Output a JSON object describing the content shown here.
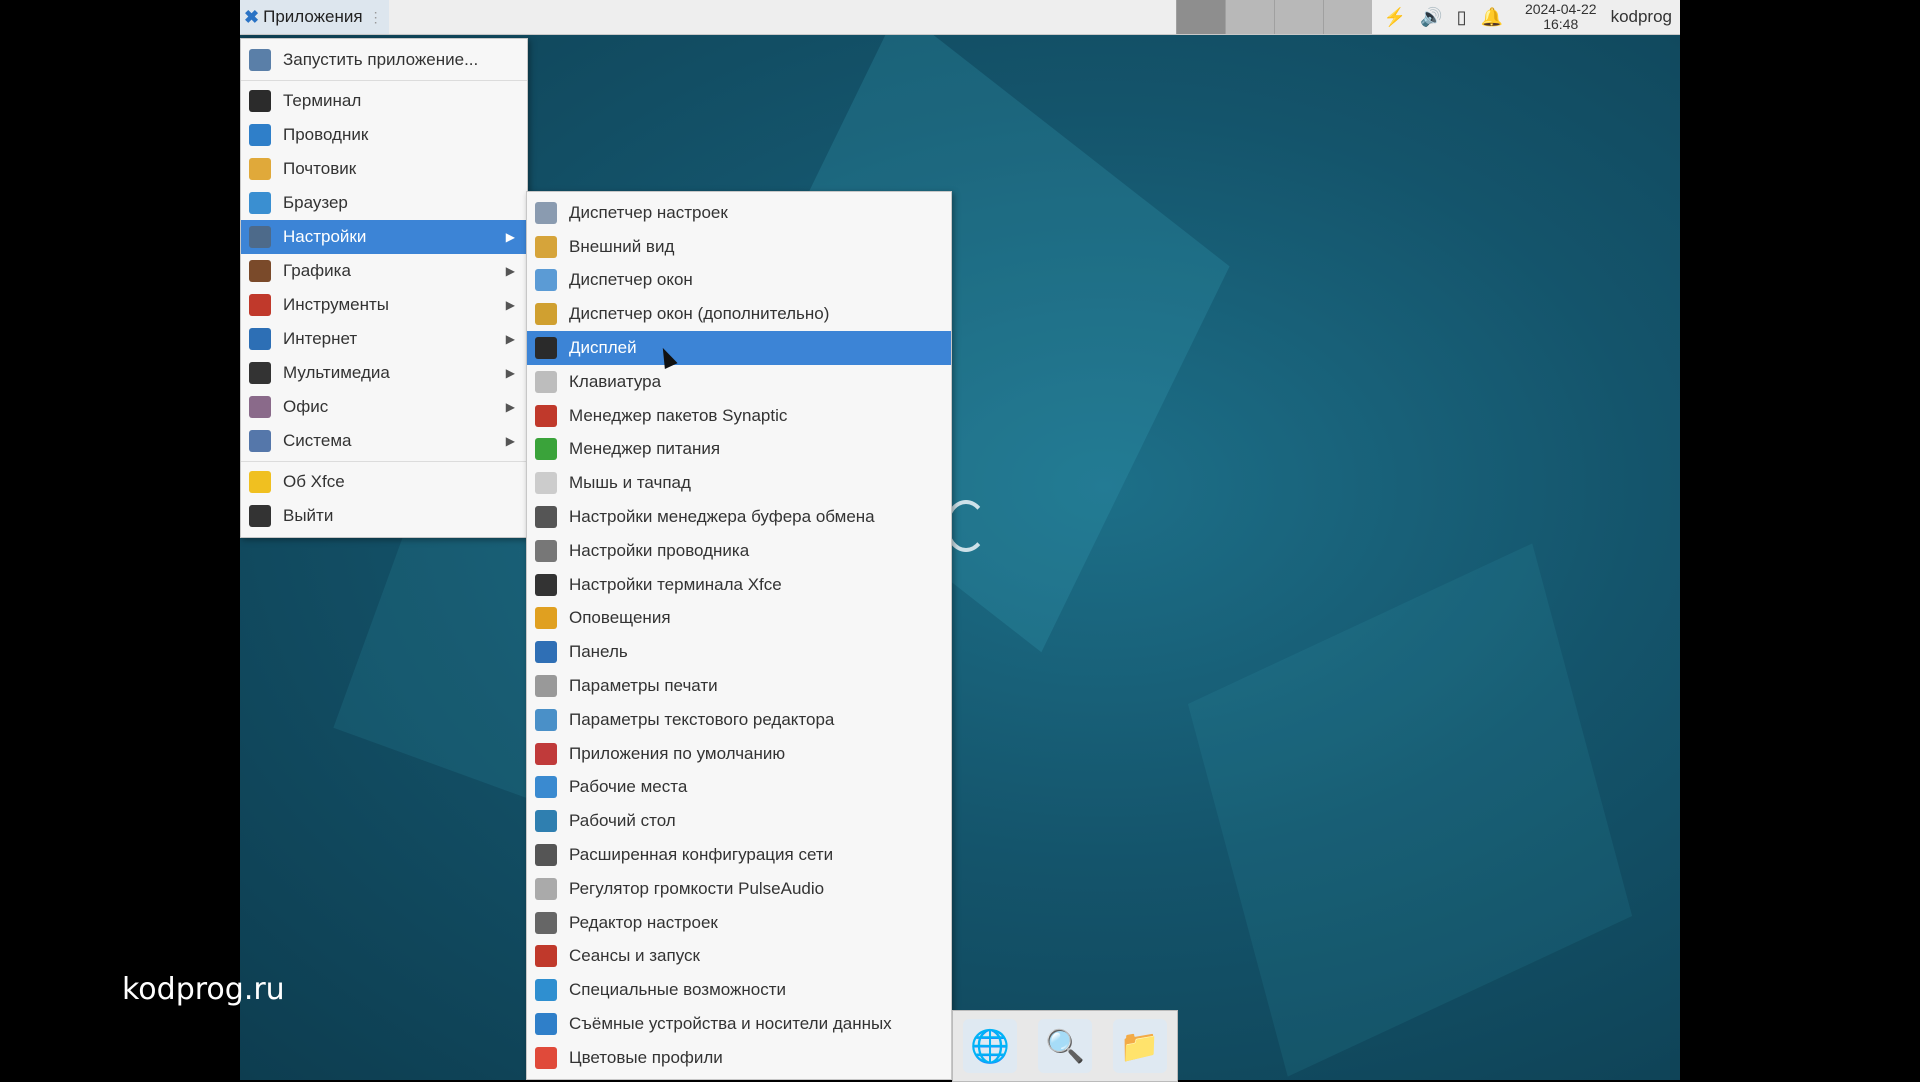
{
  "panel": {
    "apps_label": "Приложения",
    "date": "2024-04-22",
    "time": "16:48",
    "user": "kodprog"
  },
  "main_menu": [
    {
      "label": "Запустить приложение...",
      "icon": "magnifier-icon",
      "color": "#5a7fa8"
    },
    {
      "label": "Терминал",
      "icon": "terminal-icon",
      "color": "#2b2b2b"
    },
    {
      "label": "Проводник",
      "icon": "file-manager-icon",
      "color": "#2f7fc9"
    },
    {
      "label": "Почтовик",
      "icon": "mail-icon",
      "color": "#e0a93a"
    },
    {
      "label": "Браузер",
      "icon": "browser-globe-icon",
      "color": "#3a8fd1"
    },
    {
      "label": "Настройки",
      "icon": "settings-icon",
      "color": "#4d6a8a",
      "submenu": true
    },
    {
      "label": "Графика",
      "icon": "brush-icon",
      "color": "#7a4a2a",
      "submenu": true
    },
    {
      "label": "Инструменты",
      "icon": "tools-icon",
      "color": "#c0392b",
      "submenu": true
    },
    {
      "label": "Интернет",
      "icon": "internet-globe-icon",
      "color": "#2d6fb5",
      "submenu": true
    },
    {
      "label": "Мультимедиа",
      "icon": "multimedia-icon",
      "color": "#333333",
      "submenu": true
    },
    {
      "label": "Офис",
      "icon": "office-icon",
      "color": "#8a6a8a",
      "submenu": true
    },
    {
      "label": "Система",
      "icon": "system-gear-icon",
      "color": "#5577aa",
      "submenu": true
    },
    {
      "label": "Об Xfce",
      "icon": "star-icon",
      "color": "#f0c020"
    },
    {
      "label": "Выйти",
      "icon": "logout-icon",
      "color": "#333333"
    }
  ],
  "sub_menu": [
    {
      "label": "Диспетчер настроек",
      "icon": "settings-manager-icon",
      "color": "#8a9bb0"
    },
    {
      "label": "Внешний вид",
      "icon": "appearance-icon",
      "color": "#d6a43a"
    },
    {
      "label": "Диспетчер окон",
      "icon": "window-manager-icon",
      "color": "#5b9bd5"
    },
    {
      "label": "Диспетчер окон (дополнительно)",
      "icon": "window-manager-tweaks-icon",
      "color": "#d0a030"
    },
    {
      "label": "Дисплей",
      "icon": "display-icon",
      "color": "#2a2a2a"
    },
    {
      "label": "Клавиатура",
      "icon": "keyboard-icon",
      "color": "#bdbdbd"
    },
    {
      "label": "Менеджер пакетов Synaptic",
      "icon": "synaptic-icon",
      "color": "#c0392b"
    },
    {
      "label": "Менеджер питания",
      "icon": "power-manager-icon",
      "color": "#3aa33a"
    },
    {
      "label": "Мышь и тачпад",
      "icon": "mouse-icon",
      "color": "#cccccc"
    },
    {
      "label": "Настройки менеджера буфера обмена",
      "icon": "clipboard-icon",
      "color": "#555555"
    },
    {
      "label": "Настройки проводника",
      "icon": "file-manager-settings-icon",
      "color": "#777777"
    },
    {
      "label": "Настройки терминала Xfce",
      "icon": "terminal-settings-icon",
      "color": "#333333"
    },
    {
      "label": "Оповещения",
      "icon": "bell-icon",
      "color": "#e0a020"
    },
    {
      "label": "Панель",
      "icon": "panel-icon",
      "color": "#2f6fb5"
    },
    {
      "label": "Параметры печати",
      "icon": "printer-icon",
      "color": "#999999"
    },
    {
      "label": "Параметры текстового редактора",
      "icon": "text-editor-icon",
      "color": "#4a90c8"
    },
    {
      "label": "Приложения по умолчанию",
      "icon": "default-apps-icon",
      "color": "#c03a3a"
    },
    {
      "label": "Рабочие места",
      "icon": "workspaces-icon",
      "color": "#3a8ad0"
    },
    {
      "label": "Рабочий стол",
      "icon": "desktop-icon",
      "color": "#2f7fb0"
    },
    {
      "label": "Расширенная конфигурация сети",
      "icon": "network-config-icon",
      "color": "#555555"
    },
    {
      "label": "Регулятор громкости PulseAudio",
      "icon": "volume-control-icon",
      "color": "#aaaaaa"
    },
    {
      "label": "Редактор настроек",
      "icon": "settings-editor-icon",
      "color": "#666666"
    },
    {
      "label": "Сеансы и запуск",
      "icon": "rocket-icon",
      "color": "#c0392b"
    },
    {
      "label": "Специальные возможности",
      "icon": "accessibility-icon",
      "color": "#2f8fd0"
    },
    {
      "label": "Съёмные устройства и носители данных",
      "icon": "removable-drive-icon",
      "color": "#2f7fc9"
    },
    {
      "label": "Цветовые профили",
      "icon": "color-profiles-icon",
      "color": "#e04a3a"
    }
  ],
  "highlight": {
    "main_index": 5,
    "sub_index": 4,
    "color": "#3c84d6"
  },
  "watermark": "kodprog.ru"
}
